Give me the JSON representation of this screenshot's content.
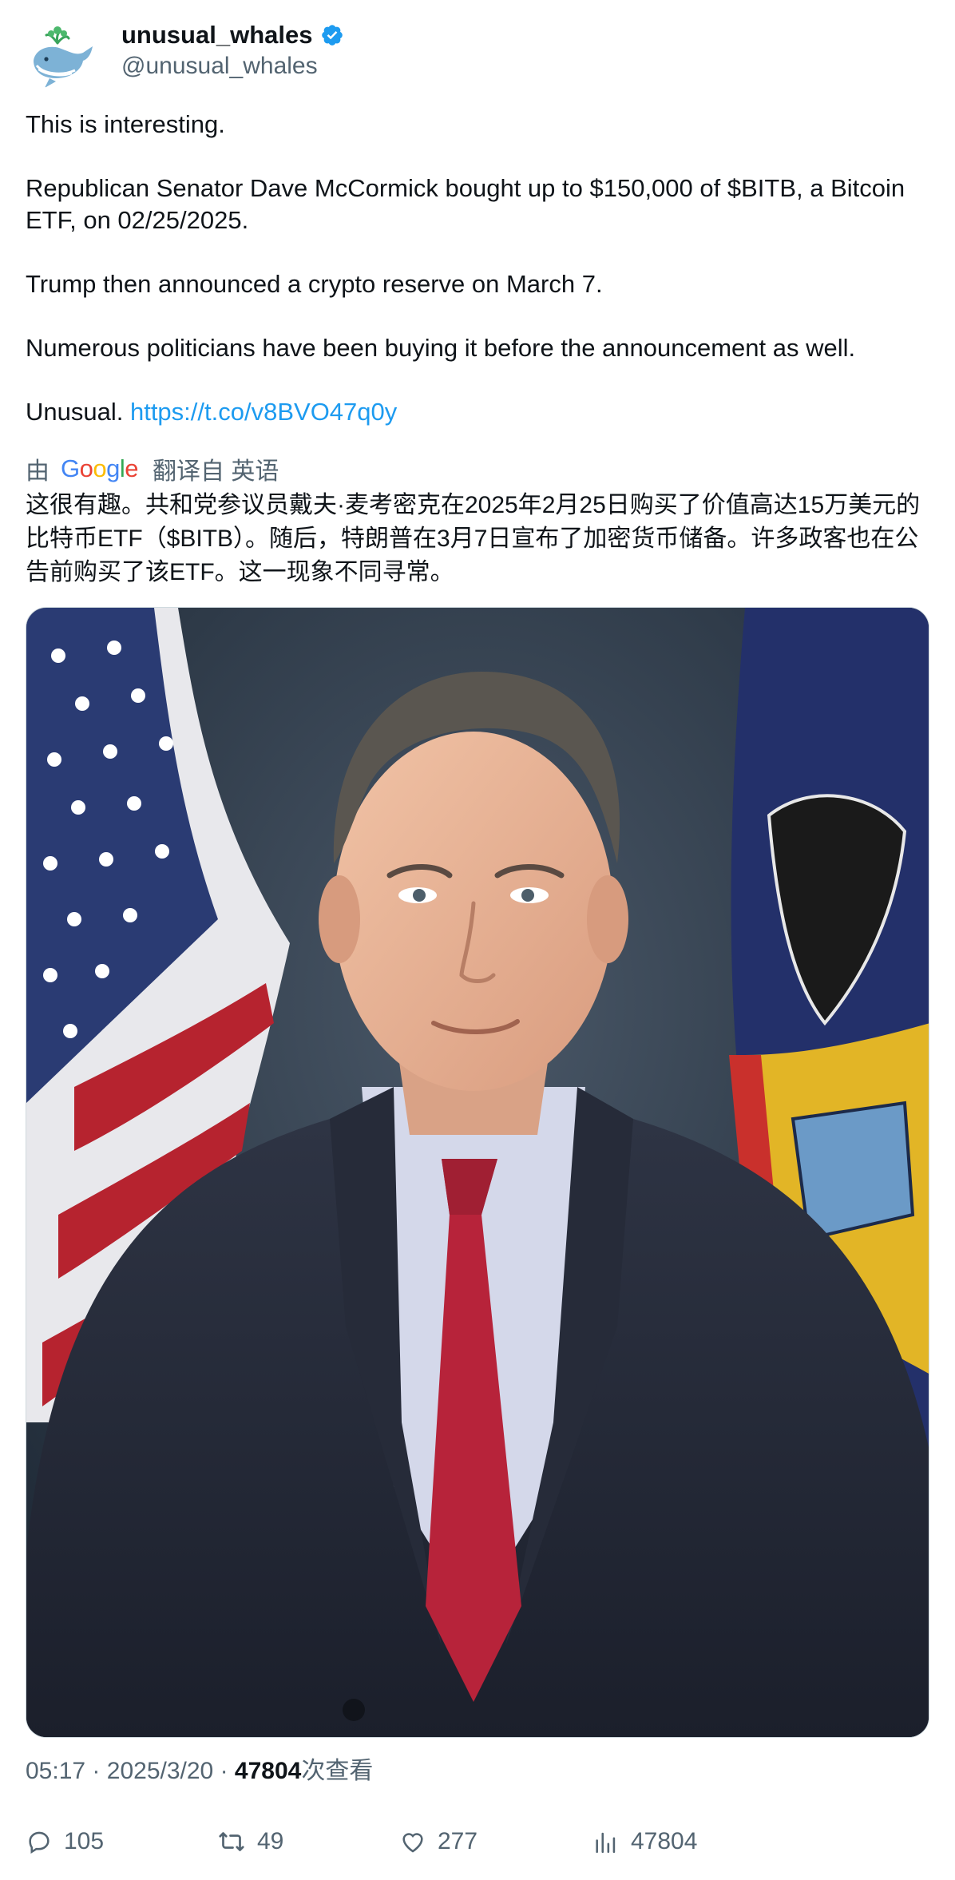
{
  "author": {
    "display_name": "unusual_whales",
    "handle": "@unusual_whales",
    "verified": true,
    "avatar_icon": "whale-avatar-icon"
  },
  "tweet": {
    "paragraphs": [
      "This is interesting.",
      "Republican Senator Dave McCormick bought up to $150,000 of $BITB, a Bitcoin ETF, on 02/25/2025.",
      "Trump then announced a crypto reserve on March 7.",
      "Numerous politicians have been buying it before the announcement as well."
    ],
    "last_text": "Unusual. ",
    "link_text": "https://t.co/v8BVO47q0y"
  },
  "translation": {
    "prefix": "由",
    "provider": "Google",
    "suffix": "翻译自 英语",
    "text": "这很有趣。共和党参议员戴夫·麦考密克在2025年2月25日购买了价值高达15万美元的比特币ETF（$BITB）。随后，特朗普在3月7日宣布了加密货币储备。许多政客也在公告前购买了该ETF。这一现象不同寻常。"
  },
  "meta": {
    "time": "05:17",
    "date": "2025/3/20",
    "separator": "·",
    "views": "47804",
    "views_label": "次查看"
  },
  "actions": {
    "replies": "105",
    "retweets": "49",
    "likes": "277",
    "views": "47804"
  },
  "colors": {
    "link": "#1d9bf0",
    "verified": "#1d9bf0",
    "secondary_text": "#536471",
    "primary_text": "#0f1419"
  }
}
